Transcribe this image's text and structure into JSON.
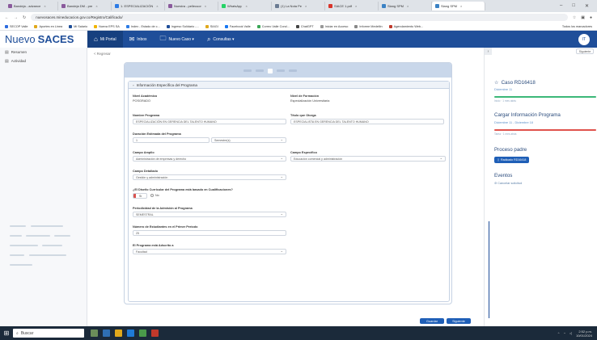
{
  "browser": {
    "tabs": [
      {
        "label": "Bandeja - advance",
        "color": "#8a5a9c"
      },
      {
        "label": "Bandeja DM - pre",
        "color": "#8a5a9c"
      },
      {
        "label": "1. ESPECIALIZACIÓN",
        "color": "#2c7be5"
      },
      {
        "label": "Nuestra - pellecuor",
        "color": "#8a5a9c"
      },
      {
        "label": "WhatsApp",
        "color": "#25d366"
      },
      {
        "label": "(1) La Nota Pe",
        "color": "#6b7c93"
      },
      {
        "label": "SIACE 1.pdf",
        "color": "#d9342b"
      },
      {
        "label": "Slang SPM",
        "color": "#3b82c4"
      },
      {
        "label": "Slang SPM",
        "color": "#3b82c4",
        "active": true
      }
    ],
    "url": "nuevosaces.mineducacion.gov.co/Registro/Calificado/",
    "bookmarks": [
      {
        "label": "SECOP Valle",
        "color": "#2d6cdf"
      },
      {
        "label": "Aportes en Linea",
        "color": "#e0a81c"
      },
      {
        "label": "Mi Salario",
        "color": "#1f4e99"
      },
      {
        "label": "Nueva EPS SA",
        "color": "#f0b400"
      },
      {
        "label": "Index - Estado de c...",
        "color": "#2c7be5"
      },
      {
        "label": "Ingreso Solidario -...",
        "color": "#1f4e99"
      },
      {
        "label": "SIAGI",
        "color": "#e0a81c"
      },
      {
        "label": "Facebook Valle",
        "color": "#1877f2"
      },
      {
        "label": "Correo Valle Cond...",
        "color": "#3aa757"
      },
      {
        "label": "ChatGPT",
        "color": "#444444"
      },
      {
        "label": "Iniciar en Acceso",
        "color": "#999999"
      },
      {
        "label": "Informe Medellín",
        "color": "#888888"
      },
      {
        "label": "Agendamiento Web...",
        "color": "#c0392b"
      }
    ],
    "bookmarks_right": "Todos los marcadores"
  },
  "app": {
    "logo_a": "Nuevo",
    "logo_b": "SACES",
    "nav": [
      {
        "label": "Mi Portal",
        "icon": "home"
      },
      {
        "label": "Inbox",
        "icon": "inbox"
      },
      {
        "label": "Nuevo Caso ▾",
        "icon": "folder"
      },
      {
        "label": "Consultas ▾",
        "icon": "search"
      }
    ],
    "avatar": "IT"
  },
  "sidebar": {
    "items": [
      {
        "label": "Resumen"
      },
      {
        "label": "Actividad"
      }
    ]
  },
  "main": {
    "back": "< Regresar",
    "section_title": "Información Específica del Programa",
    "fields": {
      "nivel_academico_label": "Nivel Académico",
      "nivel_academico_value": "POSGRADO",
      "nivel_formacion_label": "Nivel de Formación",
      "nivel_formacion_value": "Especialización Universitaria",
      "nombre_programa_label": "Nombre Programa",
      "nombre_programa_value": "ESPECIALIZACIÓN EN GERENCIA DEL TALENTO HUMANO",
      "titulo_label": "Título que Otorga",
      "titulo_value": "ESPECIALISTA EN GERENCIA DEL TALENTO HUMANO",
      "duracion_label": "Duración Estimada del Programa",
      "duracion_value": "1",
      "duracion_unit": "Semestre(s)",
      "campo_amplio_label": "Campo Amplio",
      "campo_amplio_value": "Administración de empresas y derecho",
      "campo_especifico_label": "Campo Específico",
      "campo_especifico_value": "Educación comercial y administración",
      "campo_detallado_label": "Campo Detallado",
      "campo_detallado_value": "Gestión y administración",
      "cualificaciones_label": "¿El Diseño Curricular del Programa está basado en Cualificaciones?",
      "radio_si": "Sí",
      "radio_no": "No",
      "periodicidad_label": "Periodicidad de la Admisión al Programa",
      "periodicidad_value": "SEMESTRAL",
      "estudiantes_label": "Número de Estudiantes en el Primer Periodo",
      "estudiantes_value": "25",
      "adscrito_label": "El Programa está Adscrito a",
      "adscrito_value": "Facultad"
    },
    "buttons": {
      "save": "Guardar",
      "next": "Siguiente"
    }
  },
  "right_panel": {
    "toggle": "›",
    "top_link": "Siguiente",
    "caso_title": "Caso RD16418",
    "caso_date": "Diciembre 11",
    "caso_meta": "Inicio · 1 mes atrás",
    "cargar_title": "Cargar Información Programa",
    "cargar_date": "Diciembre 11 - Diciembre 18",
    "cargar_meta": "Tarea · 1 mes atrás",
    "proceso_title": "Proceso padre",
    "proceso_button": "Radicado RD16418",
    "eventos_title": "Eventos",
    "eventos_link": "Cancelar solicitud",
    "colors": {
      "green": "#3cb878",
      "red": "#e0524c",
      "accent": "#1f5fb7"
    }
  },
  "taskbar": {
    "search": "Buscar",
    "time": "2:52 p.m.",
    "date": "10/01/2024"
  }
}
